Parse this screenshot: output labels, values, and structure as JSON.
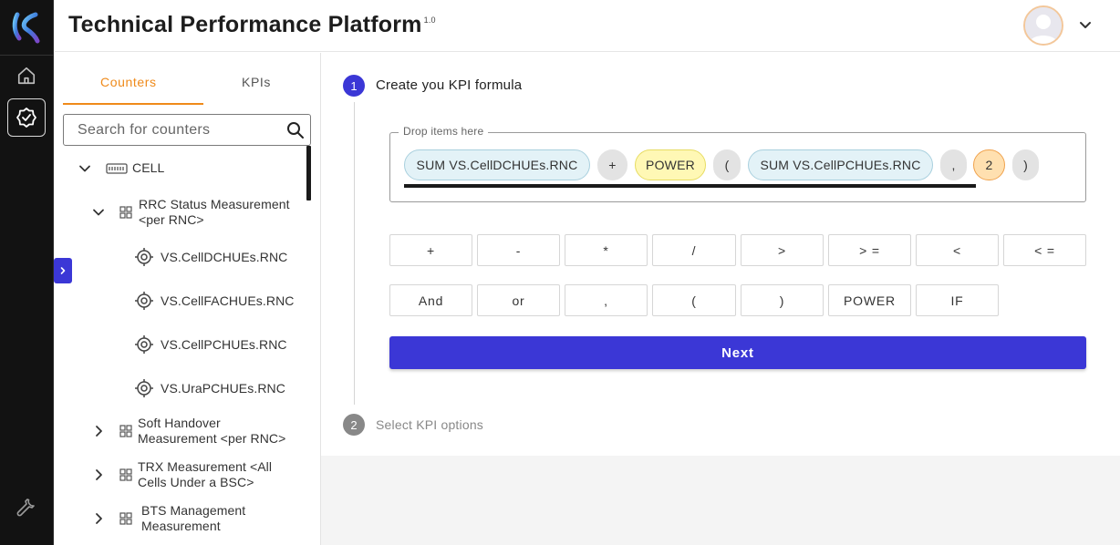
{
  "app": {
    "title": "Technical Performance Platform",
    "version": "1.0"
  },
  "colors": {
    "accent": "#3b37d6",
    "tab_active": "#ef8a1a",
    "hash_button": "#f7931e",
    "rail": "#121212"
  },
  "rail": {
    "items": [
      "logo-icon",
      "home-icon",
      "verified-badge-icon",
      "wrench-icon"
    ]
  },
  "sidebar": {
    "tabs": [
      {
        "label": "Counters",
        "active": true
      },
      {
        "label": "KPIs",
        "active": false
      }
    ],
    "search": {
      "placeholder": "Search for counters",
      "value": ""
    },
    "tree": {
      "root": {
        "label": "CELL",
        "expanded": true
      },
      "groups": [
        {
          "label_line1": "RRC Status Measurement",
          "label_line2": "<per RNC>",
          "expanded": true,
          "items": [
            "VS.CellDCHUEs.RNC",
            "VS.CellFACHUEs.RNC",
            "VS.CellPCHUEs.RNC",
            "VS.UraPCHUEs.RNC"
          ]
        },
        {
          "label_line1": "Soft Handover",
          "label_line2": "Measurement <per RNC>",
          "expanded": false
        },
        {
          "label_line1": "TRX Measurement <All",
          "label_line2": "Cells Under a BSC>",
          "expanded": false
        },
        {
          "label_line1": "BTS Management",
          "label_line2": "Measurement",
          "expanded": false
        }
      ]
    }
  },
  "hash_button": {
    "label": "#"
  },
  "steps": [
    {
      "number": "1",
      "title": "Create you KPI formula",
      "active": true
    },
    {
      "number": "2",
      "title": "Select KPI options",
      "active": false
    }
  ],
  "formula": {
    "drop_label": "Drop items here",
    "chips": [
      {
        "text": "SUM VS.CellDCHUEs.RNC",
        "kind": "counter"
      },
      {
        "text": "+",
        "kind": "op"
      },
      {
        "text": "POWER",
        "kind": "func"
      },
      {
        "text": "(",
        "kind": "op"
      },
      {
        "text": "SUM VS.CellPCHUEs.RNC",
        "kind": "counter"
      },
      {
        "text": ",",
        "kind": "op"
      },
      {
        "text": "2",
        "kind": "num"
      },
      {
        "text": ")",
        "kind": "op"
      }
    ]
  },
  "operators": {
    "row1": [
      "+",
      "-",
      "*",
      "/",
      ">",
      "> =",
      "<",
      "< ="
    ],
    "row2": [
      "And",
      "or",
      ",",
      "(",
      ")",
      "POWER",
      "IF"
    ]
  },
  "next_button": {
    "label": "Next"
  }
}
